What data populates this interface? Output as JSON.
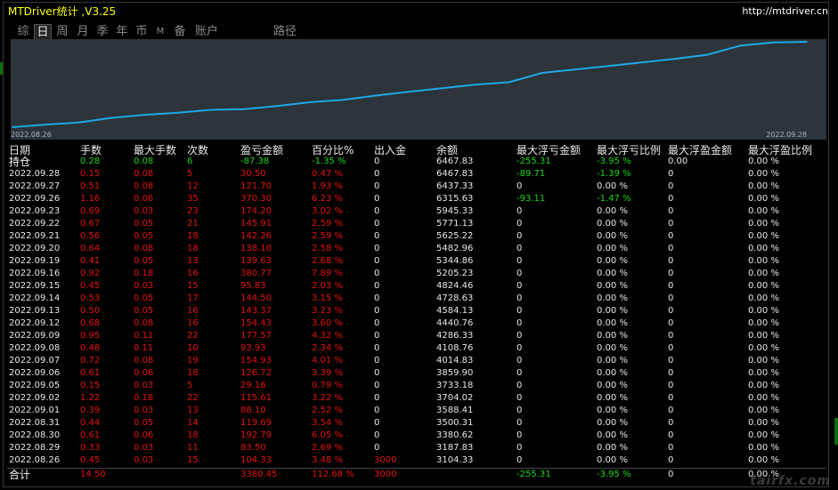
{
  "window": {
    "title": "MTDriver统计 ,V3.25",
    "url": "http://mtdriver.cn"
  },
  "tabs": [
    {
      "label": "综",
      "active": false
    },
    {
      "label": "日",
      "active": true
    },
    {
      "label": "周",
      "active": false
    },
    {
      "label": "月",
      "active": false
    },
    {
      "label": "季",
      "active": false
    },
    {
      "label": "年",
      "active": false
    },
    {
      "label": "币",
      "active": false
    },
    {
      "label": "M",
      "active": false
    },
    {
      "label": "备",
      "active": false
    },
    {
      "label": "账户",
      "active": false
    },
    {
      "label": "路径",
      "active": false
    }
  ],
  "chart_data": {
    "type": "line",
    "x_start_label": "2022.08.26",
    "x_end_label": "2022.09.28",
    "x": [
      "2022.08.26",
      "2022.08.29",
      "2022.08.30",
      "2022.08.31",
      "2022.09.01",
      "2022.09.02",
      "2022.09.05",
      "2022.09.06",
      "2022.09.07",
      "2022.09.08",
      "2022.09.09",
      "2022.09.12",
      "2022.09.13",
      "2022.09.14",
      "2022.09.15",
      "2022.09.16",
      "2022.09.19",
      "2022.09.20",
      "2022.09.21",
      "2022.09.22",
      "2022.09.23",
      "2022.09.26",
      "2022.09.27",
      "2022.09.28"
    ],
    "series": [
      {
        "values": [
          3104.33,
          3187.83,
          3380.62,
          3500.31,
          3588.41,
          3704.02,
          3733.18,
          3859.9,
          4014.83,
          4108.76,
          4286.33,
          4440.76,
          4584.13,
          4728.63,
          4824.46,
          5205.23,
          5344.86,
          5482.96,
          5625.22,
          5771.13,
          5945.33,
          6315.63,
          6437.33,
          6467.83
        ]
      }
    ],
    "colors": {
      "line": "#1ea8e6",
      "background": "#2e343b"
    }
  },
  "columns": [
    "日期",
    "手数",
    "最大手数",
    "次数",
    "盈亏金额",
    "百分比%",
    "出入金",
    "余额",
    "最大浮亏金额",
    "最大浮亏比例",
    "最大浮盈金额",
    "最大浮盈比例"
  ],
  "holding": {
    "label": "持仓",
    "lots": "0.28",
    "max_lots": "0.08",
    "count": "6",
    "pnl": "-87.38",
    "pct": "-1.35 %",
    "deposit": "0",
    "balance": "6467.83",
    "max_float_loss": "-255.31",
    "max_float_loss_pct": "-3.95 %",
    "max_float_profit": "0.00",
    "max_float_profit_pct": "0.00 %"
  },
  "rows": [
    {
      "date": "2022.09.28",
      "lots": "0.15",
      "max_lots": "0.08",
      "count": "5",
      "pnl": "30.50",
      "pct": "0.47 %",
      "deposit": "0",
      "balance": "6467.83",
      "max_float_loss": "-89.71",
      "max_float_loss_pct": "-1.39 %",
      "max_float_profit": "0",
      "max_float_profit_pct": "0.00 %"
    },
    {
      "date": "2022.09.27",
      "lots": "0.51",
      "max_lots": "0.08",
      "count": "12",
      "pnl": "121.70",
      "pct": "1.93 %",
      "deposit": "0",
      "balance": "6437.33",
      "max_float_loss": "0",
      "max_float_loss_pct": "0.00 %",
      "max_float_profit": "0",
      "max_float_profit_pct": "0.00 %"
    },
    {
      "date": "2022.09.26",
      "lots": "1.16",
      "max_lots": "0.06",
      "count": "35",
      "pnl": "370.30",
      "pct": "6.23 %",
      "deposit": "0",
      "balance": "6315.63",
      "max_float_loss": "-93.11",
      "max_float_loss_pct": "-1.47 %",
      "max_float_profit": "0",
      "max_float_profit_pct": "0.00 %"
    },
    {
      "date": "2022.09.23",
      "lots": "0.69",
      "max_lots": "0.03",
      "count": "23",
      "pnl": "174.20",
      "pct": "3.02 %",
      "deposit": "0",
      "balance": "5945.33",
      "max_float_loss": "0",
      "max_float_loss_pct": "0.00 %",
      "max_float_profit": "0",
      "max_float_profit_pct": "0.00 %"
    },
    {
      "date": "2022.09.22",
      "lots": "0.67",
      "max_lots": "0.05",
      "count": "21",
      "pnl": "145.91",
      "pct": "2.59 %",
      "deposit": "0",
      "balance": "5771.13",
      "max_float_loss": "0",
      "max_float_loss_pct": "0.00 %",
      "max_float_profit": "0",
      "max_float_profit_pct": "0.00 %"
    },
    {
      "date": "2022.09.21",
      "lots": "0.56",
      "max_lots": "0.05",
      "count": "18",
      "pnl": "142.26",
      "pct": "2.59 %",
      "deposit": "0",
      "balance": "5625.22",
      "max_float_loss": "0",
      "max_float_loss_pct": "0.00 %",
      "max_float_profit": "0",
      "max_float_profit_pct": "0.00 %"
    },
    {
      "date": "2022.09.20",
      "lots": "0.64",
      "max_lots": "0.08",
      "count": "18",
      "pnl": "138.10",
      "pct": "2.58 %",
      "deposit": "0",
      "balance": "5482.96",
      "max_float_loss": "0",
      "max_float_loss_pct": "0.00 %",
      "max_float_profit": "0",
      "max_float_profit_pct": "0.00 %"
    },
    {
      "date": "2022.09.19",
      "lots": "0.41",
      "max_lots": "0.05",
      "count": "13",
      "pnl": "139.63",
      "pct": "2.68 %",
      "deposit": "0",
      "balance": "5344.86",
      "max_float_loss": "0",
      "max_float_loss_pct": "0.00 %",
      "max_float_profit": "0",
      "max_float_profit_pct": "0.00 %"
    },
    {
      "date": "2022.09.16",
      "lots": "0.92",
      "max_lots": "0.18",
      "count": "16",
      "pnl": "380.77",
      "pct": "7.89 %",
      "deposit": "0",
      "balance": "5205.23",
      "max_float_loss": "0",
      "max_float_loss_pct": "0.00 %",
      "max_float_profit": "0",
      "max_float_profit_pct": "0.00 %"
    },
    {
      "date": "2022.09.15",
      "lots": "0.45",
      "max_lots": "0.03",
      "count": "15",
      "pnl": "95.83",
      "pct": "2.03 %",
      "deposit": "0",
      "balance": "4824.46",
      "max_float_loss": "0",
      "max_float_loss_pct": "0.00 %",
      "max_float_profit": "0",
      "max_float_profit_pct": "0.00 %"
    },
    {
      "date": "2022.09.14",
      "lots": "0.53",
      "max_lots": "0.05",
      "count": "17",
      "pnl": "144.50",
      "pct": "3.15 %",
      "deposit": "0",
      "balance": "4728.63",
      "max_float_loss": "0",
      "max_float_loss_pct": "0.00 %",
      "max_float_profit": "0",
      "max_float_profit_pct": "0.00 %"
    },
    {
      "date": "2022.09.13",
      "lots": "0.50",
      "max_lots": "0.05",
      "count": "16",
      "pnl": "143.37",
      "pct": "3.23 %",
      "deposit": "0",
      "balance": "4584.13",
      "max_float_loss": "0",
      "max_float_loss_pct": "0.00 %",
      "max_float_profit": "0",
      "max_float_profit_pct": "0.00 %"
    },
    {
      "date": "2022.09.12",
      "lots": "0.68",
      "max_lots": "0.08",
      "count": "16",
      "pnl": "154.43",
      "pct": "3.60 %",
      "deposit": "0",
      "balance": "4440.76",
      "max_float_loss": "0",
      "max_float_loss_pct": "0.00 %",
      "max_float_profit": "0",
      "max_float_profit_pct": "0.00 %"
    },
    {
      "date": "2022.09.09",
      "lots": "0.95",
      "max_lots": "0.11",
      "count": "22",
      "pnl": "177.57",
      "pct": "4.32 %",
      "deposit": "0",
      "balance": "4286.33",
      "max_float_loss": "0",
      "max_float_loss_pct": "0.00 %",
      "max_float_profit": "0",
      "max_float_profit_pct": "0.00 %"
    },
    {
      "date": "2022.09.08",
      "lots": "0.48",
      "max_lots": "0.11",
      "count": "10",
      "pnl": "93.93",
      "pct": "2.34 %",
      "deposit": "0",
      "balance": "4108.76",
      "max_float_loss": "0",
      "max_float_loss_pct": "0.00 %",
      "max_float_profit": "0",
      "max_float_profit_pct": "0.00 %"
    },
    {
      "date": "2022.09.07",
      "lots": "0.72",
      "max_lots": "0.08",
      "count": "19",
      "pnl": "154.93",
      "pct": "4.01 %",
      "deposit": "0",
      "balance": "4014.83",
      "max_float_loss": "0",
      "max_float_loss_pct": "0.00 %",
      "max_float_profit": "0",
      "max_float_profit_pct": "0.00 %"
    },
    {
      "date": "2022.09.06",
      "lots": "0.61",
      "max_lots": "0.06",
      "count": "18",
      "pnl": "126.72",
      "pct": "3.39 %",
      "deposit": "0",
      "balance": "3859.90",
      "max_float_loss": "0",
      "max_float_loss_pct": "0.00 %",
      "max_float_profit": "0",
      "max_float_profit_pct": "0.00 %"
    },
    {
      "date": "2022.09.05",
      "lots": "0.15",
      "max_lots": "0.03",
      "count": "5",
      "pnl": "29.16",
      "pct": "0.79 %",
      "deposit": "0",
      "balance": "3733.18",
      "max_float_loss": "0",
      "max_float_loss_pct": "0.00 %",
      "max_float_profit": "0",
      "max_float_profit_pct": "0.00 %"
    },
    {
      "date": "2022.09.02",
      "lots": "1.22",
      "max_lots": "0.18",
      "count": "22",
      "pnl": "115.61",
      "pct": "3.22 %",
      "deposit": "0",
      "balance": "3704.02",
      "max_float_loss": "0",
      "max_float_loss_pct": "0.00 %",
      "max_float_profit": "0",
      "max_float_profit_pct": "0.00 %"
    },
    {
      "date": "2022.09.01",
      "lots": "0.39",
      "max_lots": "0.03",
      "count": "13",
      "pnl": "88.10",
      "pct": "2.52 %",
      "deposit": "0",
      "balance": "3588.41",
      "max_float_loss": "0",
      "max_float_loss_pct": "0.00 %",
      "max_float_profit": "0",
      "max_float_profit_pct": "0.00 %"
    },
    {
      "date": "2022.08.31",
      "lots": "0.44",
      "max_lots": "0.05",
      "count": "14",
      "pnl": "119.69",
      "pct": "3.54 %",
      "deposit": "0",
      "balance": "3500.31",
      "max_float_loss": "0",
      "max_float_loss_pct": "0.00 %",
      "max_float_profit": "0",
      "max_float_profit_pct": "0.00 %"
    },
    {
      "date": "2022.08.30",
      "lots": "0.61",
      "max_lots": "0.06",
      "count": "18",
      "pnl": "192.79",
      "pct": "6.05 %",
      "deposit": "0",
      "balance": "3380.62",
      "max_float_loss": "0",
      "max_float_loss_pct": "0.00 %",
      "max_float_profit": "0",
      "max_float_profit_pct": "0.00 %"
    },
    {
      "date": "2022.08.29",
      "lots": "0.33",
      "max_lots": "0.03",
      "count": "11",
      "pnl": "83.50",
      "pct": "2.69 %",
      "deposit": "0",
      "balance": "3187.83",
      "max_float_loss": "0",
      "max_float_loss_pct": "0.00 %",
      "max_float_profit": "0",
      "max_float_profit_pct": "0.00 %"
    },
    {
      "date": "2022.08.26",
      "lots": "0.45",
      "max_lots": "0.03",
      "count": "15",
      "pnl": "104.33",
      "pct": "3.48 %",
      "deposit": "3000",
      "balance": "3104.33",
      "max_float_loss": "0",
      "max_float_loss_pct": "0.00 %",
      "max_float_profit": "0",
      "max_float_profit_pct": "0.00 %"
    }
  ],
  "total": {
    "label": "合计",
    "lots": "14.50",
    "max_lots": "",
    "count": "",
    "pnl": "3380.45",
    "pct": "112.68 %",
    "deposit": "3000",
    "balance": "",
    "max_float_loss": "-255.31",
    "max_float_loss_pct": "-3.95 %",
    "max_float_profit": "0",
    "max_float_profit_pct": "0.00 %"
  },
  "watermark": "tairfx.com"
}
